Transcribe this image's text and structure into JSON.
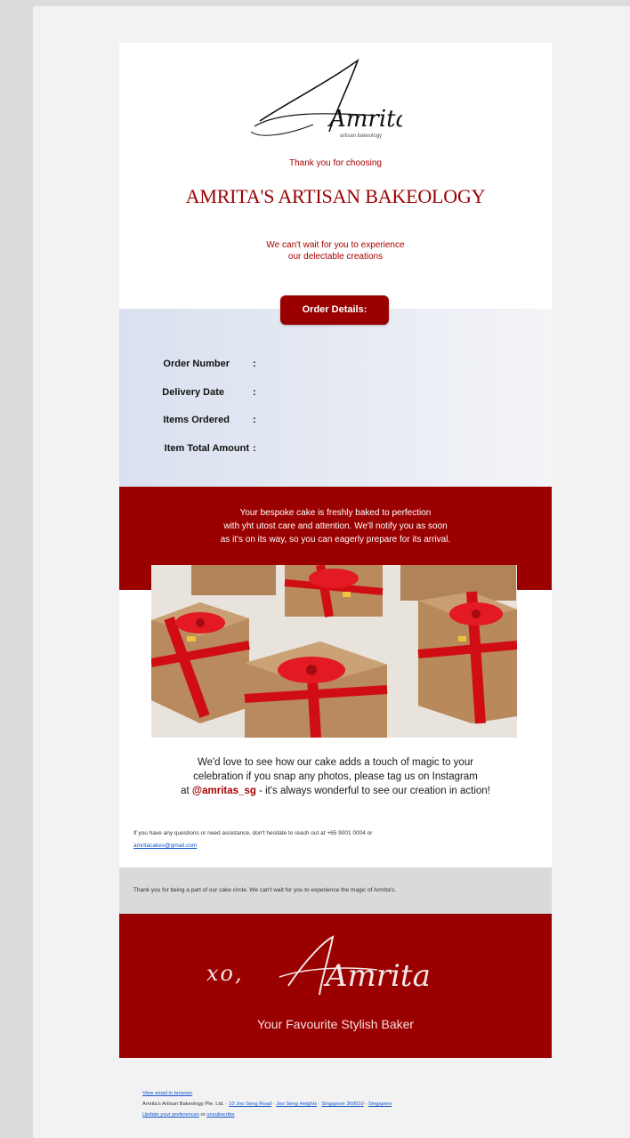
{
  "header": {
    "logo_script": "Amrita's",
    "logo_sub": "artisan bakeology",
    "thank_you": "Thank you for choosing",
    "brand_name": "AMRITA'S ARTISAN BAKEOLOGY",
    "tagline_line1": "We can't wait for you to experience",
    "tagline_line2": "our delectable creations"
  },
  "order": {
    "button_label": "Order Details:",
    "rows": [
      {
        "label": "Order Number",
        "colon": ":"
      },
      {
        "label": "Delivery Date",
        "colon": ":"
      },
      {
        "label": "Items Ordered",
        "colon": ":"
      },
      {
        "label": "Item Total Amount",
        "colon": ":"
      }
    ]
  },
  "bespoke": {
    "line1": "Your bespoke cake is freshly baked to perfection",
    "line2": "with yht utost care and attention. We'll notify you as soon",
    "line3": "as it's on its way, so you can eagerly prepare for its arrival."
  },
  "photo": {
    "description_icon": "gift-boxes-image"
  },
  "instagram": {
    "line1": "We'd love to see how our cake adds a touch of magic to your",
    "line2": "celebration if you snap any photos, please tag us on Instagram",
    "line3_prefix": "at ",
    "handle": "@amritas_sg",
    "line3_suffix": " - it's always wonderful to see our creation in action!"
  },
  "contact": {
    "text": "If you have any questions or need assistance, don't hesitate to reach out at +65 9001 0004 or",
    "email": "amritacakes@gmail.com"
  },
  "circle": {
    "text": "Thank you for being a part of our cake circle. We can't wait for you to experience the magic of Amrita's."
  },
  "signoff": {
    "xo": "xo,",
    "signature": "Amrita",
    "baker_line": "Your Favourite Stylish Baker"
  },
  "footer": {
    "view_in_browser": "View email in browser",
    "company": "Amrita's Artisan Bakeology Pte. Ltd.",
    "address_road": "10 Joo Seng Road",
    "address_heights": "Joo Seng Heights",
    "address_postal": "Singapore 360010",
    "address_country": "Singapore",
    "update_prefs": "Update your preferences",
    "or": "or",
    "unsubscribe": "unsubscribe"
  },
  "colors": {
    "brand_red": "#9b0000",
    "page_bg": "#dcdcdc",
    "link_blue": "#1155cc"
  }
}
